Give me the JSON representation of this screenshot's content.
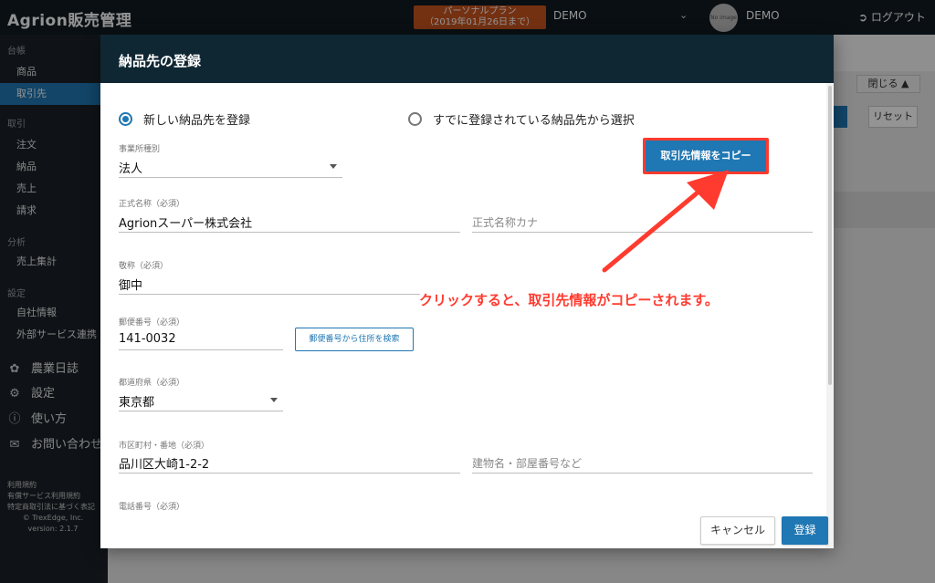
{
  "header": {
    "brand": "Agrion販売管理",
    "plan_line1": "パーソナルプラン",
    "plan_line2": "（2019年01月26日まで）",
    "account": "DEMO",
    "avatar_text": "No image",
    "user": "DEMO",
    "logout": "ログアウト"
  },
  "sidebar": {
    "sections": {
      "ledger": "台帳",
      "trade": "取引",
      "analysis": "分析",
      "settings": "設定"
    },
    "items": {
      "products": "商品",
      "clients": "取引先",
      "orders": "注文",
      "delivery": "納品",
      "sales": "売上",
      "billing": "請求",
      "sales_summary": "売上集計",
      "company_info": "自社情報",
      "external": "外部サービス連携"
    },
    "big_items": {
      "farm_diary": "農業日誌",
      "settings": "設定",
      "howto": "使い方",
      "contact": "お問い合わせ"
    },
    "footer": {
      "terms": "利用規約",
      "paid_terms": "有償サービス利用規約",
      "commerce_law": "特定商取引法に基づく表記",
      "copyright": "© TrexEdge, Inc.",
      "version": "version: 2.1.7"
    }
  },
  "background": {
    "close_label": "閉じる ▲",
    "reset_label": "リセット"
  },
  "modal": {
    "title": "納品先の登録",
    "radio_new": "新しい納品先を登録",
    "radio_existing": "すでに登録されている納品先から選択",
    "radio_selected": "new",
    "copy_button": "取引先情報をコピー",
    "zip_button": "郵便番号から住所を検索",
    "cancel": "キャンセル",
    "submit": "登録",
    "annotation": "クリックすると、取引先情報がコピーされます。",
    "fields": {
      "office_type": {
        "label": "事業所種別",
        "value": "法人"
      },
      "official_name": {
        "label": "正式名称（必須）",
        "value": "Agrionスーパー株式会社"
      },
      "official_kana": {
        "placeholder": "正式名称カナ"
      },
      "honorific": {
        "label": "敬称（必須）",
        "value": "御中"
      },
      "postal": {
        "label": "郵便番号（必須）",
        "value": "141-0032"
      },
      "prefecture": {
        "label": "都道府県（必須）",
        "value": "東京都"
      },
      "city": {
        "label": "市区町村・番地（必須）",
        "value": "品川区大崎1-2-2"
      },
      "building": {
        "placeholder": "建物名・部屋番号など"
      },
      "phone": {
        "label": "電話番号（必須）"
      }
    }
  },
  "colors": {
    "accent": "#1f77b3",
    "header_bg": "#111a22",
    "modal_header": "#0f2733",
    "plan_badge": "#c8551f",
    "annotation_red": "#ff3b2f"
  }
}
